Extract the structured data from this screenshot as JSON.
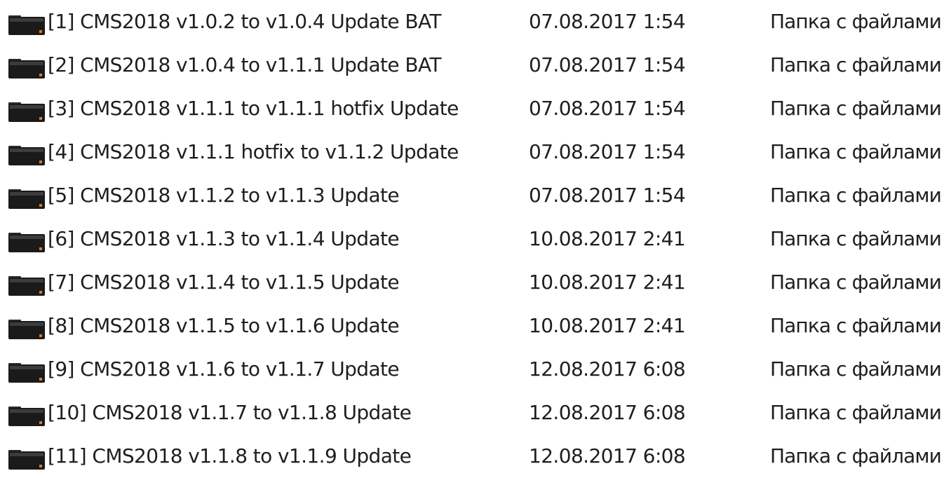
{
  "file_list": {
    "rows": [
      {
        "icon": "folder-icon",
        "name": "[1] CMS2018 v1.0.2 to v1.0.4 Update BAT",
        "date": "07.08.2017 1:54",
        "type": "Папка с файлами"
      },
      {
        "icon": "folder-icon",
        "name": "[2] CMS2018 v1.0.4 to v1.1.1 Update BAT",
        "date": "07.08.2017 1:54",
        "type": "Папка с файлами"
      },
      {
        "icon": "folder-icon",
        "name": "[3] CMS2018 v1.1.1 to v1.1.1 hotfix Update",
        "date": "07.08.2017 1:54",
        "type": "Папка с файлами"
      },
      {
        "icon": "folder-icon",
        "name": "[4] CMS2018 v1.1.1 hotfix to v1.1.2 Update",
        "date": "07.08.2017 1:54",
        "type": "Папка с файлами"
      },
      {
        "icon": "folder-icon",
        "name": "[5] CMS2018 v1.1.2 to v1.1.3 Update",
        "date": "07.08.2017 1:54",
        "type": "Папка с файлами"
      },
      {
        "icon": "folder-icon",
        "name": "[6] CMS2018 v1.1.3 to v1.1.4 Update",
        "date": "10.08.2017 2:41",
        "type": "Папка с файлами"
      },
      {
        "icon": "folder-icon",
        "name": "[7] CMS2018 v1.1.4 to v1.1.5 Update",
        "date": "10.08.2017 2:41",
        "type": "Папка с файлами"
      },
      {
        "icon": "folder-icon",
        "name": "[8] CMS2018 v1.1.5 to v1.1.6 Update",
        "date": "10.08.2017 2:41",
        "type": "Папка с файлами"
      },
      {
        "icon": "folder-icon",
        "name": "[9] CMS2018 v1.1.6 to v1.1.7 Update",
        "date": "12.08.2017 6:08",
        "type": "Папка с файлами"
      },
      {
        "icon": "folder-icon",
        "name": "[10] CMS2018 v1.1.7 to v1.1.8 Update",
        "date": "12.08.2017 6:08",
        "type": "Папка с файлами"
      },
      {
        "icon": "folder-icon",
        "name": "[11] CMS2018 v1.1.8 to v1.1.9 Update",
        "date": "12.08.2017 6:08",
        "type": "Папка с файлами"
      }
    ]
  }
}
